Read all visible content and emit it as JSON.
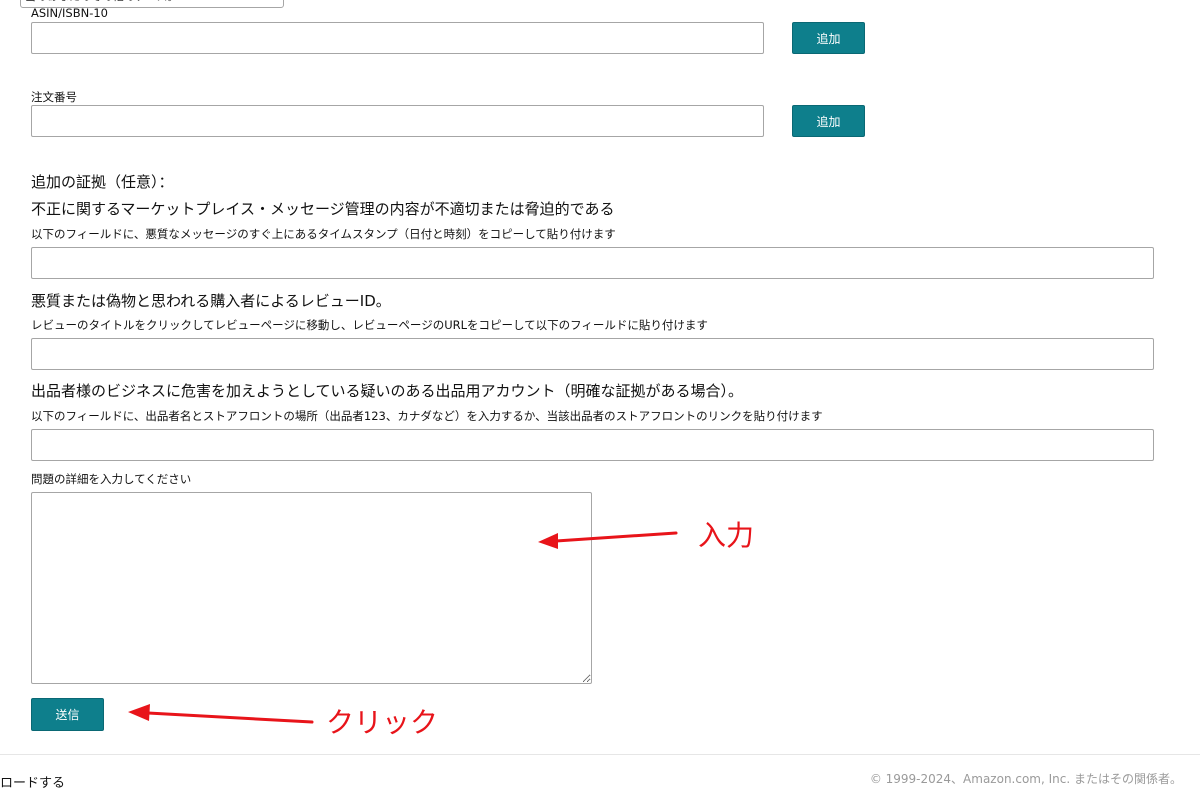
{
  "form": {
    "top_dropdown_text": "当のあなたのその他のテース。",
    "asin": {
      "label": "ASIN/ISBN-10",
      "value": "",
      "add_label": "追加"
    },
    "order": {
      "label": "注文番号",
      "value": "",
      "add_label": "追加"
    },
    "evidence": {
      "heading": "追加の証拠（任意）：",
      "message_heading": "不正に関するマーケットプレイス・メッセージ管理の内容が不適切または脅迫的である",
      "message_help": "以下のフィールドに、悪質なメッセージのすぐ上にあるタイムスタンプ（日付と時刻）をコピーして貼り付けます",
      "message_value": "",
      "review_heading": "悪質または偽物と思われる購入者によるレビューID。",
      "review_help": "レビューのタイトルをクリックしてレビューページに移動し、レビューページのURLをコピーして以下のフィールドに貼り付けます",
      "review_value": "",
      "seller_heading": "出品者様のビジネスに危害を加えようとしている疑いのある出品用アカウント（明確な証拠がある場合）。",
      "seller_help": "以下のフィールドに、出品者名とストアフロントの場所（出品者123、カナダなど）を入力するか、当該出品者のストアフロントのリンクを貼り付けます",
      "seller_value": ""
    },
    "details": {
      "label": "問題の詳細を入力してください",
      "value": ""
    },
    "submit_label": "送信"
  },
  "annotations": {
    "input_note": "入力",
    "click_note": "クリック",
    "color": "#e8141a"
  },
  "footer": {
    "left_text": "ロードする",
    "copyright": "© 1999-2024、Amazon.com, Inc. またはその関係者。"
  },
  "colors": {
    "button_teal": "#0e7f8c",
    "input_border": "#a6a6a6"
  }
}
